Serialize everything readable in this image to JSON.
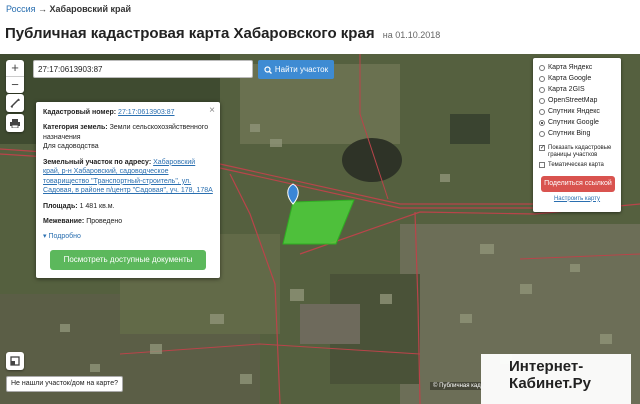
{
  "breadcrumb": {
    "root": "Россия",
    "arrow": "→",
    "current": "Хабаровский край"
  },
  "page": {
    "title": "Публичная кадастровая карта Хабаровского края",
    "date": "на 01.10.2018"
  },
  "map": {
    "zoom_in": "+",
    "zoom_out": "−",
    "search_value": "27:17:0613903:87",
    "find_button": "Найти участок",
    "not_found": "Не нашли участок/дом на карте?",
    "copyright": "© Публичная кад"
  },
  "info": {
    "cadastral_label": "Кадастровый номер:",
    "cadastral_value": "27:17:0613903:87",
    "category_label": "Категория земель:",
    "category_value": "Земли сельскохозяйственного назначения",
    "category_use": "Для садоводства",
    "address_label": "Земельный участок по адресу:",
    "address_value": "Хабаровский край, р-н Хабаровский, садоводческое товарищество \"Транспортный-строитель\", ул. Садовая, в районе п/центр \"Садовая\", уч. 178, 178А",
    "area_label": "Площадь:",
    "area_value": "1 481 кв.м.",
    "boundary_label": "Межевание:",
    "boundary_value": "Проведено",
    "more": "Подробно",
    "docs_button": "Посмотреть доступные документы"
  },
  "layers": {
    "options": [
      {
        "label": "Карта Яндекс",
        "selected": false
      },
      {
        "label": "Карта Google",
        "selected": false
      },
      {
        "label": "Карта 2GIS",
        "selected": false
      },
      {
        "label": "OpenStreetMap",
        "selected": false
      },
      {
        "label": "Спутник Яндекс",
        "selected": false
      },
      {
        "label": "Спутник Google",
        "selected": true
      },
      {
        "label": "Спутник Bing",
        "selected": false
      }
    ],
    "show_boundaries": "Показать кадастровые границы участков",
    "show_boundaries_checked": true,
    "thematic": "Тематическая карта",
    "thematic_checked": false,
    "share_button": "Поделиться ссылкой",
    "setup_link": "Настроить карту"
  },
  "watermark": {
    "line1": "Интернет-",
    "line2": "Кабинет.Ру"
  }
}
